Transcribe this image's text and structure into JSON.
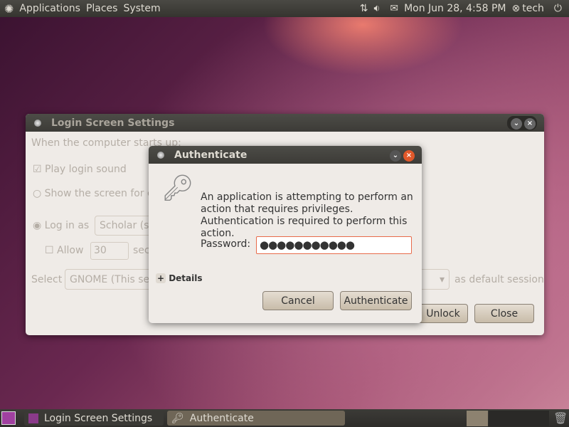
{
  "top_panel": {
    "menus": [
      "Applications",
      "Places",
      "System"
    ],
    "datetime": "Mon Jun 28,  4:58 PM",
    "user": "tech"
  },
  "login_window": {
    "title": "Login Screen Settings",
    "startup_label": "When the computer starts up:",
    "play_sound": "Play login sound",
    "show_screen": "Show the screen for ch",
    "login_as": "Log in as",
    "user_value": "Scholar (sc",
    "allow": "Allow",
    "seconds_value": "30",
    "seconds_suffix": "sec",
    "select": "Select",
    "session_value": "GNOME (This ses",
    "default_session": "as default session",
    "unlock": "Unlock",
    "close": "Close"
  },
  "auth_dialog": {
    "title": "Authenticate",
    "message": "An application is attempting to perform an action that requires privileges. Authentication is required to perform this action.",
    "password_label": "Password:",
    "password_value": "●●●●●●●●●●●",
    "details": "Details",
    "cancel": "Cancel",
    "authenticate": "Authenticate"
  },
  "taskbar": {
    "items": [
      "Login Screen Settings",
      "Authenticate"
    ]
  }
}
